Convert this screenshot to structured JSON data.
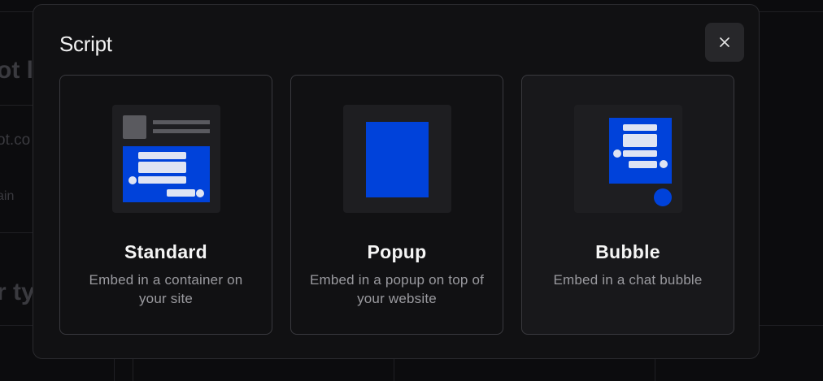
{
  "background": {
    "fragments": [
      "ot l",
      "ot.co",
      "ain",
      "r ty"
    ]
  },
  "modal": {
    "title": "Script",
    "close_icon": "close-icon",
    "options": [
      {
        "title": "Standard",
        "description": "Embed in a container on your site",
        "icon": "standard-embed-illustration"
      },
      {
        "title": "Popup",
        "description": "Embed in a popup on top of your website",
        "icon": "popup-embed-illustration"
      },
      {
        "title": "Bubble",
        "description": "Embed in a chat bubble",
        "icon": "bubble-embed-illustration"
      }
    ]
  },
  "colors": {
    "accent": "#0042da",
    "background": "#0c0c0e",
    "modal": "#111113"
  }
}
